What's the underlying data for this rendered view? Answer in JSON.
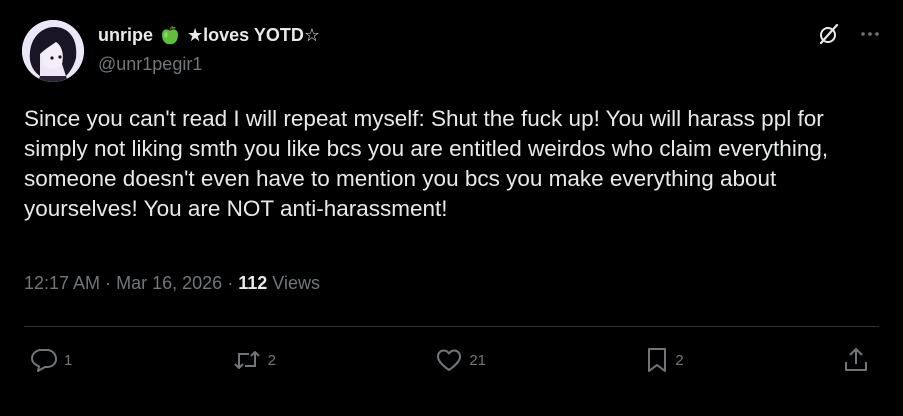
{
  "user": {
    "display_name": "unripe",
    "name_suffix": "★loves YOTD☆",
    "handle": "@unr1pegir1",
    "emoji": "green-apple-icon"
  },
  "tweet": {
    "text": "Since you can't read I will repeat myself: Shut the fuck up! You will harass ppl for simply not liking smth you like bcs you are entitled weirdos who claim everything, someone doesn't even have to mention you bcs you make everything about yourselves! You are NOT anti-harassment!",
    "time": "12:17 AM",
    "sep1": "·",
    "date": "Mar 16, 2026",
    "sep2": "·",
    "views_count": "112",
    "views_label": "Views"
  },
  "actions": {
    "replies": "1",
    "reposts": "2",
    "likes": "21",
    "bookmarks": "2"
  },
  "colors": {
    "background": "#000000",
    "text": "#e7e9ea",
    "muted": "#71767b",
    "divider": "#2f3336"
  }
}
